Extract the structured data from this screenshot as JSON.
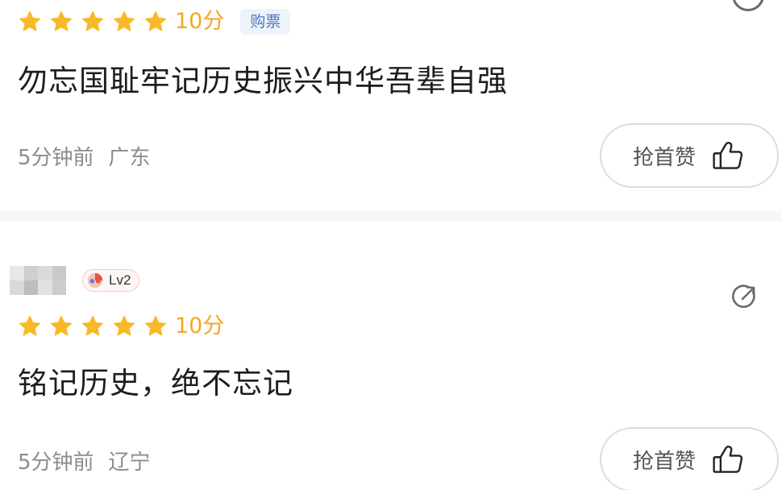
{
  "colors": {
    "star": "#f7b928",
    "score": "#f5a623",
    "badge_bg": "#eef3fb",
    "badge_text": "#4a78c4",
    "meta": "#8c8c8c",
    "divider": "#f7f7f7"
  },
  "reviews": [
    {
      "stars": 5,
      "score": "10分",
      "badge": "购票",
      "comment": "勿忘国耻牢记历史振兴中华吾辈自强",
      "time": "5分钟前",
      "location": "广东",
      "like_label": "抢首赞",
      "icons": [
        "star-icon",
        "thumbs-up-icon",
        "share-icon"
      ]
    },
    {
      "level": "Lv2",
      "stars": 5,
      "score": "10分",
      "comment": "铭记历史，绝不忘记",
      "time": "5分钟前",
      "location": "辽宁",
      "like_label": "抢首赞",
      "icons": [
        "avatar",
        "level-badge-icon",
        "star-icon",
        "share-icon",
        "thumbs-up-icon"
      ]
    }
  ]
}
